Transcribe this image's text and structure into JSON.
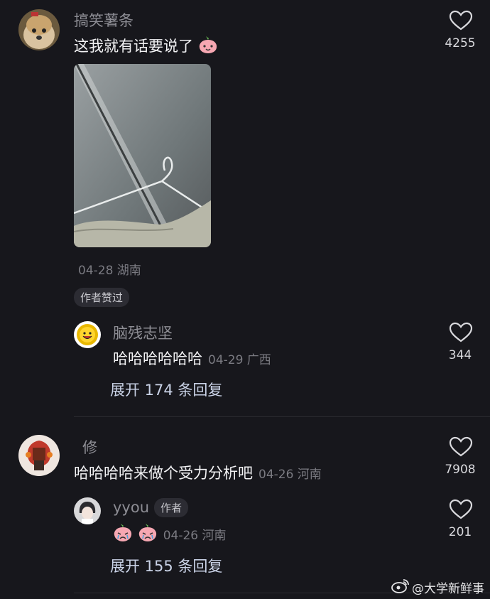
{
  "comments": [
    {
      "username": "搞笑薯条",
      "text": "这我就有话要说了",
      "likes": "4255",
      "date_location": "04-28 湖南",
      "author_badge": "作者赞过",
      "reply": {
        "username": "脑残志坚",
        "text": "哈哈哈哈哈哈",
        "date_location": "04-29 广西",
        "likes": "344"
      },
      "expand_label": "展开 174 条回复"
    },
    {
      "username": "修",
      "text": "哈哈哈哈来做个受力分析吧",
      "date_location": "04-26 河南",
      "likes": "7908",
      "reply": {
        "username": "yyou",
        "author_tag": "作者",
        "date_location": "04-26 河南",
        "likes": "201"
      },
      "expand_label": "展开 155 条回复"
    }
  ],
  "watermark": "@大学新鲜事",
  "icons": [
    "heart-icon",
    "smile-emoji-icon",
    "weibo-logo-icon"
  ]
}
